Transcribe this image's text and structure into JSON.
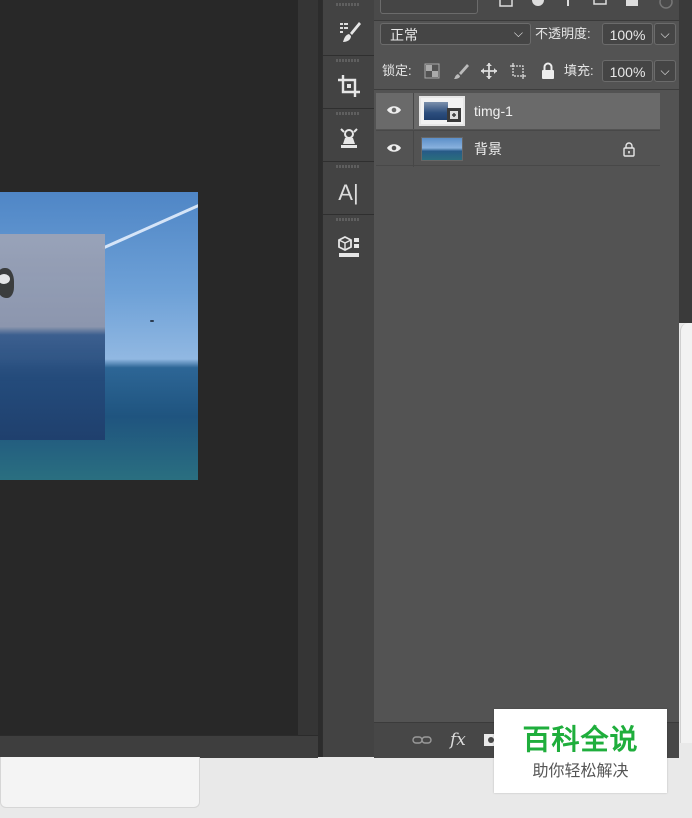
{
  "blend_mode": {
    "value": "正常",
    "arrow": "⌵"
  },
  "opacity": {
    "label": "不透明度:",
    "value": "100%",
    "arrow": "⌵"
  },
  "lock": {
    "label": "锁定:"
  },
  "fill": {
    "label": "填充:",
    "value": "100%",
    "arrow": "⌵"
  },
  "layers": [
    {
      "name": "timg-1",
      "selected": true
    },
    {
      "name": "背景",
      "selected": false,
      "locked": true
    }
  ],
  "toolbar": {
    "text_tool_glyph": "A|"
  },
  "panel_bottom": {
    "fx_label": "fx"
  },
  "watermark": {
    "title": "百科全说",
    "subtitle": "助你轻松解决"
  },
  "colors": {
    "panel_bg": "#535353",
    "selected_row": "#696969",
    "canvas_bg": "#282828",
    "watermark_green": "#1fae3c"
  }
}
